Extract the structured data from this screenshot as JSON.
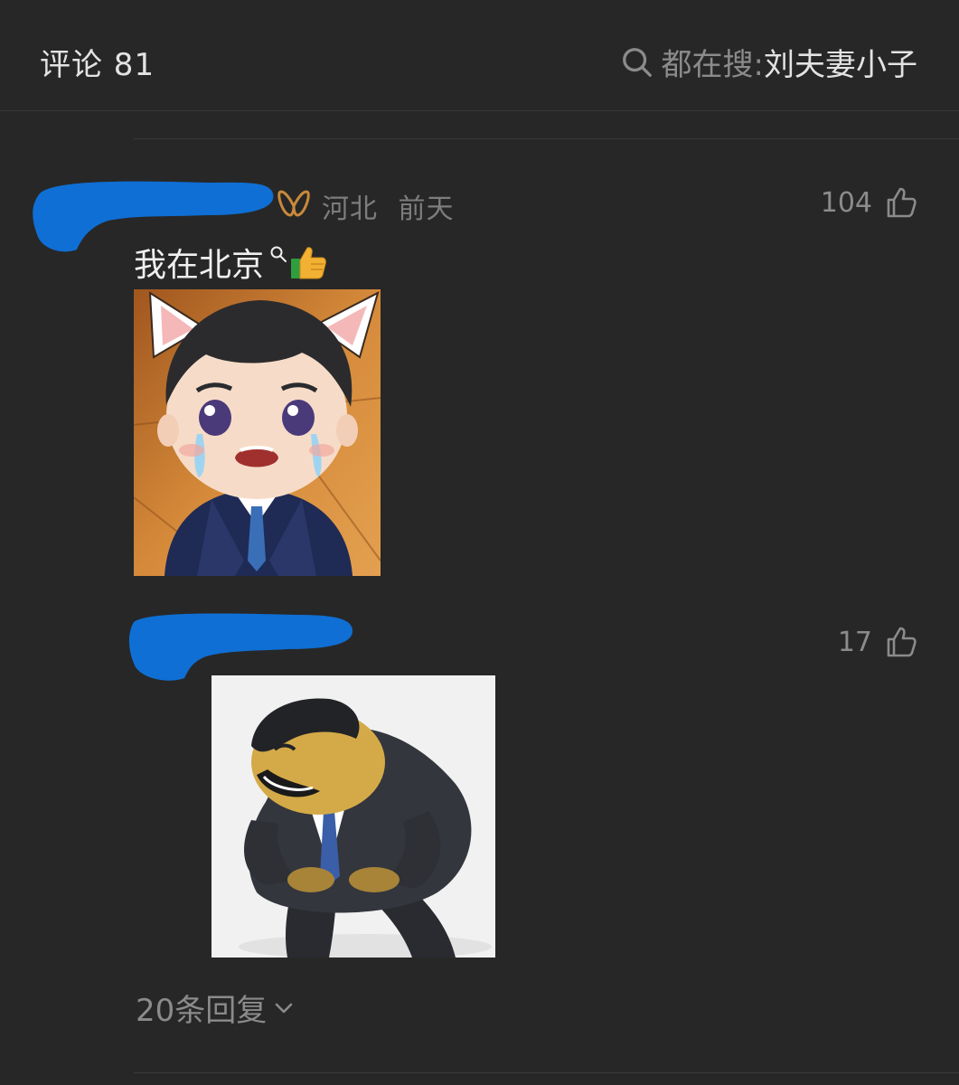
{
  "header": {
    "title": "评论 81",
    "search_prefix": "都在搜:",
    "search_term": "刘夫妻小子"
  },
  "comments": [
    {
      "location": "河北",
      "time": "前天",
      "likes": "104",
      "text": "我在北京"
    },
    {
      "likes": "17"
    }
  ],
  "replies": {
    "label": "20条回复"
  },
  "icons": {
    "search": "search-icon",
    "vip": "vip-badge-icon",
    "like": "thumbs-up-icon",
    "expand": "chevron-down-icon"
  },
  "colors": {
    "background": "#272727",
    "redact_blue": "#0f6fd4",
    "vip_orange": "#c98a3a",
    "muted_text": "#8b8b8b"
  }
}
